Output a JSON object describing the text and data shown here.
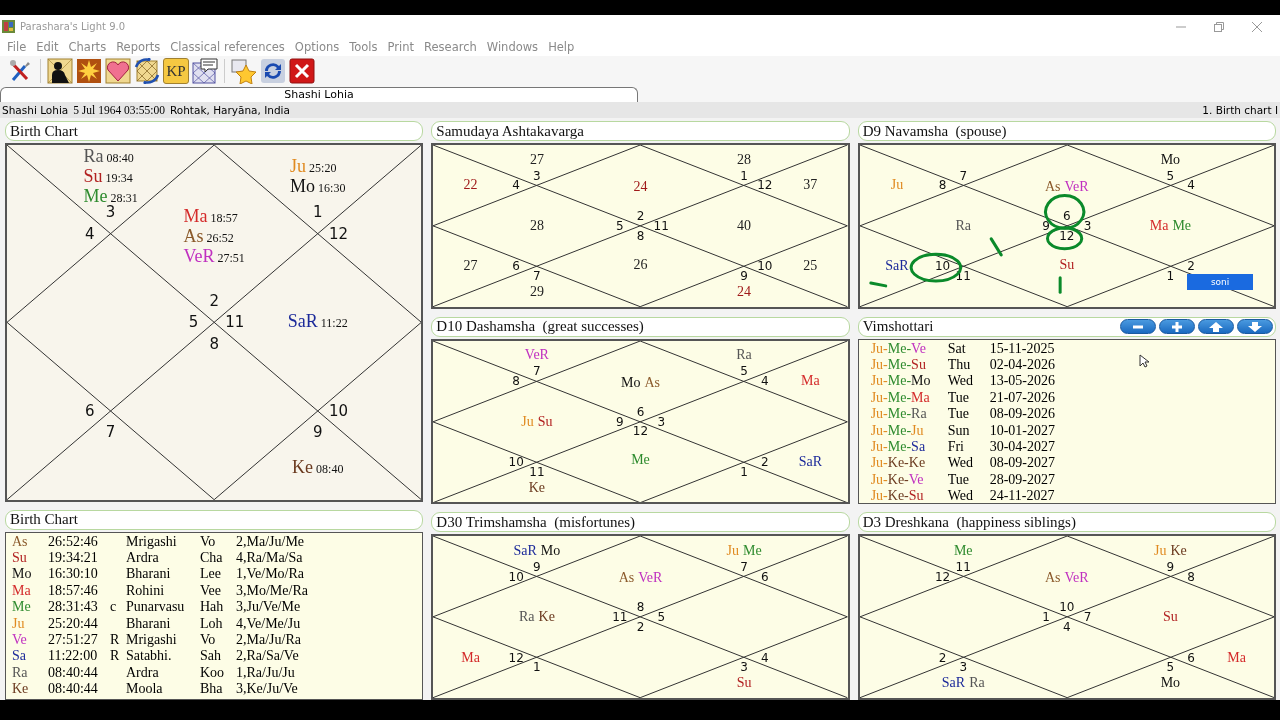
{
  "window": {
    "title": "Parashara's Light 9.0"
  },
  "menu": [
    "File",
    "Edit",
    "Charts",
    "Reports",
    "Classical references",
    "Options",
    "Tools",
    "Print",
    "Research",
    "Windows",
    "Help"
  ],
  "toolbar": [
    {
      "kind": "tools"
    },
    {
      "kind": "separator"
    },
    {
      "kind": "person"
    },
    {
      "kind": "sun"
    },
    {
      "kind": "heart"
    },
    {
      "kind": "rotate"
    },
    {
      "kind": "text",
      "label": "KP"
    },
    {
      "kind": "chat"
    },
    {
      "kind": "separator"
    },
    {
      "kind": "star"
    },
    {
      "kind": "sync"
    },
    {
      "kind": "close"
    }
  ],
  "tab": {
    "label": "Shashi Lohia",
    "selected": true
  },
  "info": {
    "name": "Shashi Lohia",
    "datetime": "5 Jul 1964 03:55:00",
    "place": "Rohtak, Haryāna, India",
    "view": "1. Birth chart I"
  },
  "columns": [
    [
      {
        "kind": "chart",
        "title": "Birth Chart",
        "houses": [
          {
            "number": "3",
            "planets": [
              {
                "name": "Ra",
                "color": "#555555",
                "deg": "08:40"
              },
              {
                "name": "Su",
                "color": "#b22222",
                "deg": "19:34"
              },
              {
                "name": "Me",
                "color": "#2e8b2e",
                "deg": "28:31"
              }
            ]
          },
          {
            "number": "1",
            "planets": [
              {
                "name": "Ju",
                "color": "#e08a20",
                "deg": "25:20"
              },
              {
                "name": "Mo",
                "color": "#111111",
                "deg": "16:30"
              }
            ]
          },
          {
            "number": "4"
          },
          {
            "number": "2",
            "planets": [
              {
                "name": "Ma",
                "color": "#d42a2a",
                "deg": "18:57"
              },
              {
                "name": "As",
                "color": "#8b5a2b",
                "deg": "26:52"
              },
              {
                "name": "VeR",
                "color": "#c030c0",
                "deg": "27:51"
              }
            ]
          },
          {
            "number": "12"
          },
          {
            "number": "5"
          },
          {
            "number": "11",
            "planets": [
              {
                "name": "SaR",
                "color": "#1c2a9a",
                "deg": "11:22"
              }
            ]
          },
          {
            "number": "6"
          },
          {
            "number": "8"
          },
          {
            "number": "10"
          },
          {
            "number": "7"
          },
          {
            "number": "9",
            "planets": [
              {
                "name": "Ke",
                "color": "#6b3a1f",
                "deg": "08:40"
              }
            ]
          }
        ]
      },
      {
        "kind": "table",
        "title": "Birth Chart",
        "rows": [
          {
            "planet": "As",
            "color": "#8b5a2b",
            "deg": "26:52:46",
            "nakshatra": "Mrigashi",
            "syllable": "Vo",
            "pada": "2,Ma/Ju/Me"
          },
          {
            "planet": "Su",
            "color": "#b22222",
            "deg": "19:34:21",
            "nakshatra": "Ardra",
            "syllable": "Cha",
            "pada": "4,Ra/Ma/Sa"
          },
          {
            "planet": "Mo",
            "color": "#111111",
            "deg": "16:30:10",
            "nakshatra": "Bharani",
            "syllable": "Lee",
            "pada": "1,Ve/Mo/Ra"
          },
          {
            "planet": "Ma",
            "color": "#d42a2a",
            "deg": "18:57:46",
            "nakshatra": "Rohini",
            "syllable": "Vee",
            "pada": "3,Mo/Me/Ra"
          },
          {
            "planet": "Me",
            "color": "#2e8b2e",
            "deg": "28:31:43",
            "flag": "c",
            "nakshatra": "Punarvasu",
            "syllable": "Hah",
            "pada": "3,Ju/Ve/Me"
          },
          {
            "planet": "Ju",
            "color": "#e08a20",
            "deg": "25:20:44",
            "nakshatra": "Bharani",
            "syllable": "Loh",
            "pada": "4,Ve/Me/Ju"
          },
          {
            "planet": "Ve",
            "color": "#c030c0",
            "deg": "27:51:27",
            "flag": "R",
            "nakshatra": "Mrigashi",
            "syllable": "Vo",
            "pada": "2,Ma/Ju/Ra"
          },
          {
            "planet": "Sa",
            "color": "#1c2a9a",
            "deg": "11:22:00",
            "flag": "R",
            "nakshatra": "Satabhi.",
            "syllable": "Sah",
            "pada": "2,Ra/Sa/Ve"
          },
          {
            "planet": "Ra",
            "color": "#555555",
            "deg": "08:40:44",
            "nakshatra": "Ardra",
            "syllable": "Koo",
            "pada": "1,Ra/Ju/Ju"
          },
          {
            "planet": "Ke",
            "color": "#6b3a1f",
            "deg": "08:40:44",
            "nakshatra": "Moola",
            "syllable": "Bha",
            "pada": "3,Ke/Ju/Ve"
          }
        ]
      }
    ],
    [
      {
        "kind": "points",
        "title": "Samudaya Ashtakavarga",
        "houses": [
          {
            "number": "3",
            "points": "27",
            "color": "#222222"
          },
          {
            "number": "1",
            "points": "28",
            "color": "#222222"
          },
          {
            "number": "4",
            "points": "22",
            "color": "#a01a1a"
          },
          {
            "number": "2",
            "points": "24",
            "color": "#a01a1a"
          },
          {
            "number": "12",
            "points": "37",
            "color": "#222222"
          },
          {
            "number": "5",
            "points": "28",
            "color": "#222222"
          },
          {
            "number": "11",
            "points": "40",
            "color": "#222222"
          },
          {
            "number": "6",
            "points": "27",
            "color": "#222222"
          },
          {
            "number": "8",
            "points": "26",
            "color": "#222222"
          },
          {
            "number": "10",
            "points": "25",
            "color": "#222222"
          },
          {
            "number": "7",
            "points": "29",
            "color": "#222222"
          },
          {
            "number": "9",
            "points": "24",
            "color": "#a01a1a"
          }
        ]
      },
      {
        "kind": "chart",
        "title": "D10 Dashamsha  (great successes)",
        "houses": [
          {
            "number": "7",
            "planets": [
              {
                "name": "VeR",
                "color": "#c030c0"
              }
            ]
          },
          {
            "number": "5",
            "planets": [
              {
                "name": "Ra",
                "color": "#555555"
              }
            ]
          },
          {
            "number": "8"
          },
          {
            "number": "6",
            "planets": [
              {
                "name": "Mo",
                "color": "#111111"
              },
              {
                "name": "As",
                "color": "#8b5a2b"
              }
            ]
          },
          {
            "number": "4",
            "planets": [
              {
                "name": "Ma",
                "color": "#d42a2a"
              }
            ]
          },
          {
            "number": "9",
            "planets": [
              {
                "name": "Ju",
                "color": "#e08a20"
              },
              {
                "name": "Su",
                "color": "#b22222"
              }
            ]
          },
          {
            "number": "3"
          },
          {
            "number": "10"
          },
          {
            "number": "12",
            "planets": [
              {
                "name": "Me",
                "color": "#2e8b2e"
              }
            ]
          },
          {
            "number": "2",
            "planets": [
              {
                "name": "SaR",
                "color": "#1c2a9a"
              }
            ]
          },
          {
            "number": "11",
            "planets": [
              {
                "name": "Ke",
                "color": "#6b3a1f"
              }
            ]
          },
          {
            "number": "1"
          }
        ]
      },
      {
        "kind": "chart",
        "title": "D30 Trimshamsha  (misfortunes)",
        "houses": [
          {
            "number": "9",
            "planets": [
              {
                "name": "SaR",
                "color": "#1c2a9a"
              },
              {
                "name": "Mo",
                "color": "#111111"
              }
            ]
          },
          {
            "number": "7",
            "planets": [
              {
                "name": "Ju",
                "color": "#e08a20"
              },
              {
                "name": "Me",
                "color": "#2e8b2e"
              }
            ]
          },
          {
            "number": "10"
          },
          {
            "number": "8",
            "planets": [
              {
                "name": "As",
                "color": "#8b5a2b"
              },
              {
                "name": "VeR",
                "color": "#c030c0"
              }
            ]
          },
          {
            "number": "6"
          },
          {
            "number": "11",
            "planets": [
              {
                "name": "Ra",
                "color": "#555555"
              },
              {
                "name": "Ke",
                "color": "#6b3a1f"
              }
            ]
          },
          {
            "number": "5"
          },
          {
            "number": "12",
            "planets": [
              {
                "name": "Ma",
                "color": "#d42a2a"
              }
            ]
          },
          {
            "number": "2"
          },
          {
            "number": "4"
          },
          {
            "number": "1"
          },
          {
            "number": "3",
            "planets": [
              {
                "name": "Su",
                "color": "#b22222"
              }
            ]
          }
        ]
      }
    ],
    [
      {
        "kind": "chart",
        "title": "D9 Navamsha  (spouse)",
        "ink_marks": true,
        "overlay_label": "soni",
        "houses": [
          {
            "number": "7"
          },
          {
            "number": "5",
            "planets": [
              {
                "name": "Mo",
                "color": "#111111"
              }
            ]
          },
          {
            "number": "8",
            "planets": [
              {
                "name": "Ju",
                "color": "#e08a20"
              }
            ]
          },
          {
            "number": "6",
            "planets": [
              {
                "name": "As",
                "color": "#8b5a2b"
              },
              {
                "name": "VeR",
                "color": "#c030c0"
              }
            ]
          },
          {
            "number": "4"
          },
          {
            "number": "9",
            "planets": [
              {
                "name": "Ra",
                "color": "#555555"
              }
            ]
          },
          {
            "number": "3",
            "planets": [
              {
                "name": "Ma",
                "color": "#d42a2a"
              },
              {
                "name": "Me",
                "color": "#2e8b2e"
              }
            ]
          },
          {
            "number": "10",
            "planets": [
              {
                "name": "SaR",
                "color": "#1c2a9a"
              }
            ]
          },
          {
            "number": "12",
            "planets": [
              {
                "name": "Su",
                "color": "#b22222"
              }
            ]
          },
          {
            "number": "2"
          },
          {
            "number": "11"
          },
          {
            "number": "1"
          }
        ]
      },
      {
        "kind": "dasha",
        "title": "Vimshottari",
        "buttons": [
          {
            "kind": "minus"
          },
          {
            "kind": "plus"
          },
          {
            "kind": "up"
          },
          {
            "kind": "down"
          }
        ],
        "rows": [
          {
            "period": [
              {
                "text": "Ju-",
                "color": "#e08a20"
              },
              {
                "text": "Me-",
                "color": "#2e8b2e"
              },
              {
                "text": "Ve",
                "color": "#c030c0"
              }
            ],
            "day": "Sat",
            "date": "15-11-2025"
          },
          {
            "period": [
              {
                "text": "Ju-",
                "color": "#e08a20"
              },
              {
                "text": "Me-",
                "color": "#2e8b2e"
              },
              {
                "text": "Su",
                "color": "#b22222"
              }
            ],
            "day": "Thu",
            "date": "02-04-2026"
          },
          {
            "period": [
              {
                "text": "Ju-",
                "color": "#e08a20"
              },
              {
                "text": "Me-",
                "color": "#2e8b2e"
              },
              {
                "text": "Mo",
                "color": "#111111"
              }
            ],
            "day": "Wed",
            "date": "13-05-2026"
          },
          {
            "period": [
              {
                "text": "Ju-",
                "color": "#e08a20"
              },
              {
                "text": "Me-",
                "color": "#2e8b2e"
              },
              {
                "text": "Ma",
                "color": "#d42a2a"
              }
            ],
            "day": "Tue",
            "date": "21-07-2026"
          },
          {
            "period": [
              {
                "text": "Ju-",
                "color": "#e08a20"
              },
              {
                "text": "Me-",
                "color": "#2e8b2e"
              },
              {
                "text": "Ra",
                "color": "#555555"
              }
            ],
            "day": "Tue",
            "date": "08-09-2026"
          },
          {
            "period": [
              {
                "text": "Ju-",
                "color": "#e08a20"
              },
              {
                "text": "Me-",
                "color": "#2e8b2e"
              },
              {
                "text": "Ju",
                "color": "#e08a20"
              }
            ],
            "day": "Sun",
            "date": "10-01-2027"
          },
          {
            "period": [
              {
                "text": "Ju-",
                "color": "#e08a20"
              },
              {
                "text": "Me-",
                "color": "#2e8b2e"
              },
              {
                "text": "Sa",
                "color": "#1c2a9a"
              }
            ],
            "day": "Fri",
            "date": "30-04-2027"
          },
          {
            "period": [
              {
                "text": "Ju-",
                "color": "#e08a20"
              },
              {
                "text": "Ke-",
                "color": "#6b3a1f"
              },
              {
                "text": "Ke",
                "color": "#6b3a1f"
              }
            ],
            "day": "Wed",
            "date": "08-09-2027"
          },
          {
            "period": [
              {
                "text": "Ju-",
                "color": "#e08a20"
              },
              {
                "text": "Ke-",
                "color": "#6b3a1f"
              },
              {
                "text": "Ve",
                "color": "#c030c0"
              }
            ],
            "day": "Tue",
            "date": "28-09-2027"
          },
          {
            "period": [
              {
                "text": "Ju-",
                "color": "#e08a20"
              },
              {
                "text": "Ke-",
                "color": "#6b3a1f"
              },
              {
                "text": "Su",
                "color": "#b22222"
              }
            ],
            "day": "Wed",
            "date": "24-11-2027"
          }
        ]
      },
      {
        "kind": "chart",
        "title": "D3 Dreshkana  (happiness siblings)",
        "houses": [
          {
            "number": "11",
            "planets": [
              {
                "name": "Me",
                "color": "#2e8b2e"
              }
            ]
          },
          {
            "number": "9",
            "planets": [
              {
                "name": "Ju",
                "color": "#e08a20"
              },
              {
                "name": "Ke",
                "color": "#6b3a1f"
              }
            ]
          },
          {
            "number": "12"
          },
          {
            "number": "10",
            "planets": [
              {
                "name": "As",
                "color": "#8b5a2b"
              },
              {
                "name": "VeR",
                "color": "#c030c0"
              }
            ]
          },
          {
            "number": "8"
          },
          {
            "number": "1"
          },
          {
            "number": "7",
            "planets": [
              {
                "name": "Su",
                "color": "#b22222"
              }
            ]
          },
          {
            "number": "2"
          },
          {
            "number": "4"
          },
          {
            "number": "6",
            "planets": [
              {
                "name": "Ma",
                "color": "#d42a2a"
              }
            ]
          },
          {
            "number": "3",
            "planets": [
              {
                "name": "SaR",
                "color": "#1c2a9a"
              },
              {
                "name": "Ra",
                "color": "#555555"
              }
            ]
          },
          {
            "number": "5",
            "planets": [
              {
                "name": "Mo",
                "color": "#111111"
              }
            ]
          }
        ]
      }
    ]
  ]
}
